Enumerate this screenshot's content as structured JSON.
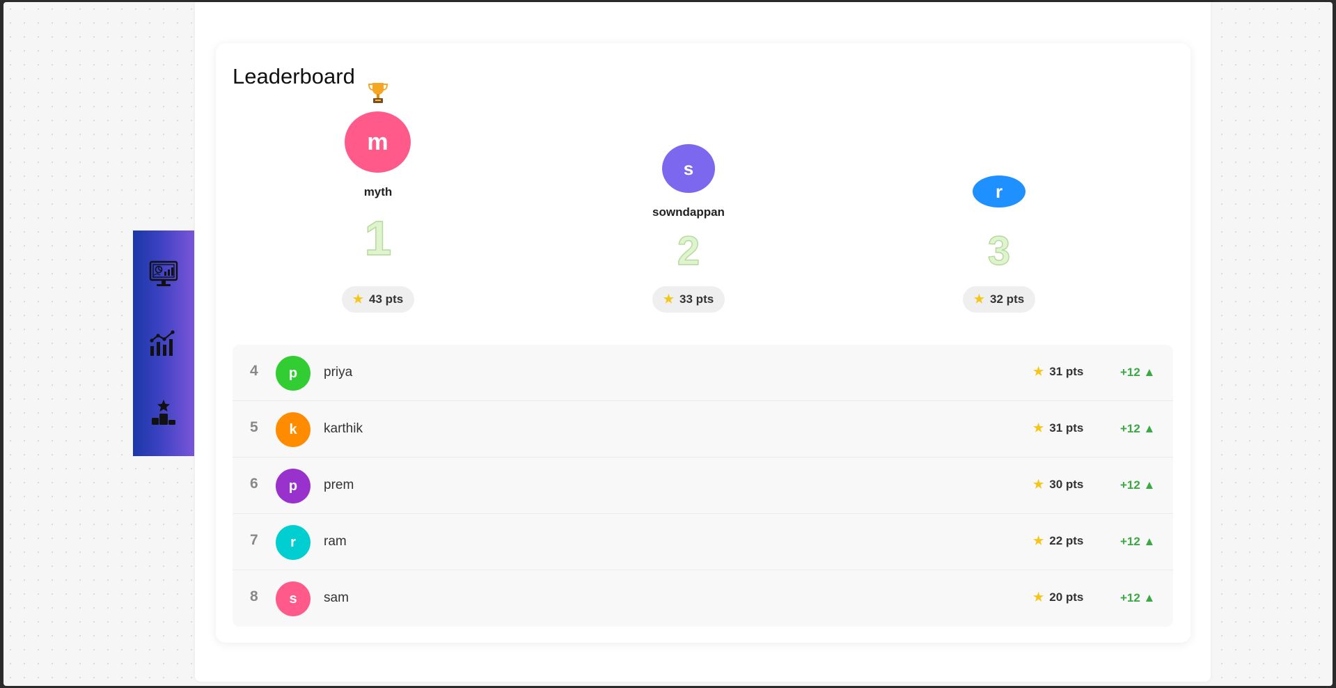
{
  "nav": {
    "items": [
      {
        "name": "dashboard-icon"
      },
      {
        "name": "analytics-icon"
      },
      {
        "name": "leaderboard-icon"
      }
    ]
  },
  "leaderboard": {
    "title": "Leaderboard",
    "podium": [
      {
        "initial": "m",
        "name": "myth",
        "rank": "1",
        "points": "43 pts",
        "color": "#ff5a8a"
      },
      {
        "initial": "s",
        "name": "sowndappan",
        "rank": "2",
        "points": "33 pts",
        "color": "#7b68ee"
      },
      {
        "initial": "r",
        "name": "",
        "rank": "3",
        "points": "32 pts",
        "color": "#1e90ff"
      }
    ],
    "rows": [
      {
        "rank": "4",
        "initial": "p",
        "name": "priya",
        "points": "31 pts",
        "change": "+12 ▲",
        "color": "#32cd32"
      },
      {
        "rank": "5",
        "initial": "k",
        "name": "karthik",
        "points": "31 pts",
        "change": "+12 ▲",
        "color": "#ff8c00"
      },
      {
        "rank": "6",
        "initial": "p",
        "name": "prem",
        "points": "30 pts",
        "change": "+12 ▲",
        "color": "#9932cc"
      },
      {
        "rank": "7",
        "initial": "r",
        "name": "ram",
        "points": "22 pts",
        "change": "+12 ▲",
        "color": "#00ced1"
      },
      {
        "rank": "8",
        "initial": "s",
        "name": "sam",
        "points": "20 pts",
        "change": "+12 ▲",
        "color": "#ff5a8a"
      }
    ]
  }
}
